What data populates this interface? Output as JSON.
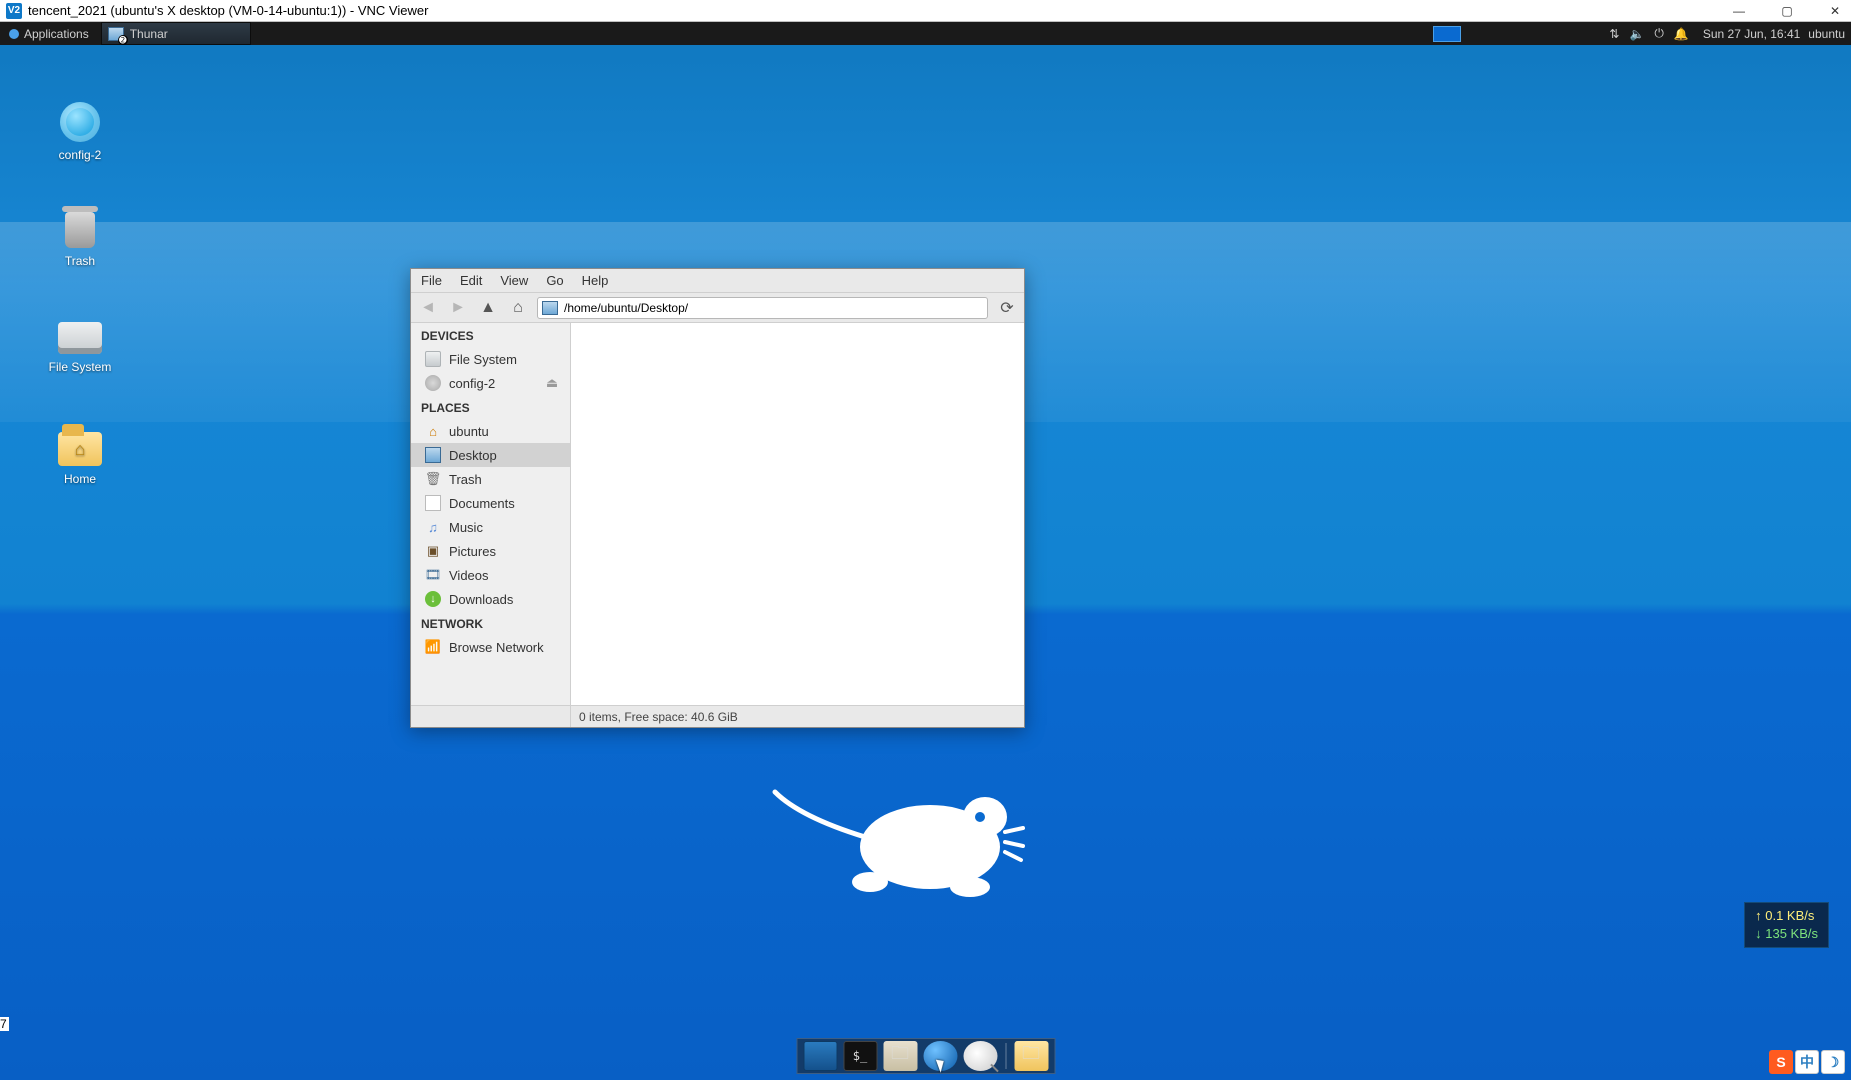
{
  "vnc": {
    "icon_text": "V2",
    "title": "tencent_2021 (ubuntu's X desktop (VM-0-14-ubuntu:1)) - VNC Viewer",
    "min": "—",
    "max": "▢",
    "close": "✕"
  },
  "page_artifact": "7",
  "xfce_panel": {
    "apps_label": "Applications",
    "task_label": "Thunar",
    "clock": "Sun 27 Jun, 16:41",
    "host": "ubuntu",
    "tray": {
      "net": "⇅",
      "vol": "🔈",
      "power": "⏻",
      "notif": "🔔"
    }
  },
  "desktop_icons": {
    "config2": "config-2",
    "trash": "Trash",
    "filesystem": "File System",
    "home": "Home"
  },
  "thunar": {
    "menu": {
      "file": "File",
      "edit": "Edit",
      "view": "View",
      "go": "Go",
      "help": "Help"
    },
    "path": "/home/ubuntu/Desktop/",
    "sidebar": {
      "devices_header": "DEVICES",
      "places_header": "PLACES",
      "network_header": "NETWORK",
      "file_system": "File System",
      "config2": "config-2",
      "ubuntu": "ubuntu",
      "desktop": "Desktop",
      "trash": "Trash",
      "documents": "Documents",
      "music": "Music",
      "pictures": "Pictures",
      "videos": "Videos",
      "downloads": "Downloads",
      "browse_network": "Browse Network"
    },
    "status": "0 items, Free space: 40.6 GiB"
  },
  "netspeed": {
    "up": "↑ 0.1 KB/s",
    "down": "↓ 135 KB/s"
  },
  "ime": {
    "sogou": "S",
    "lang": "中",
    "moon": "☽"
  },
  "dock": {
    "term_label": "$_"
  }
}
